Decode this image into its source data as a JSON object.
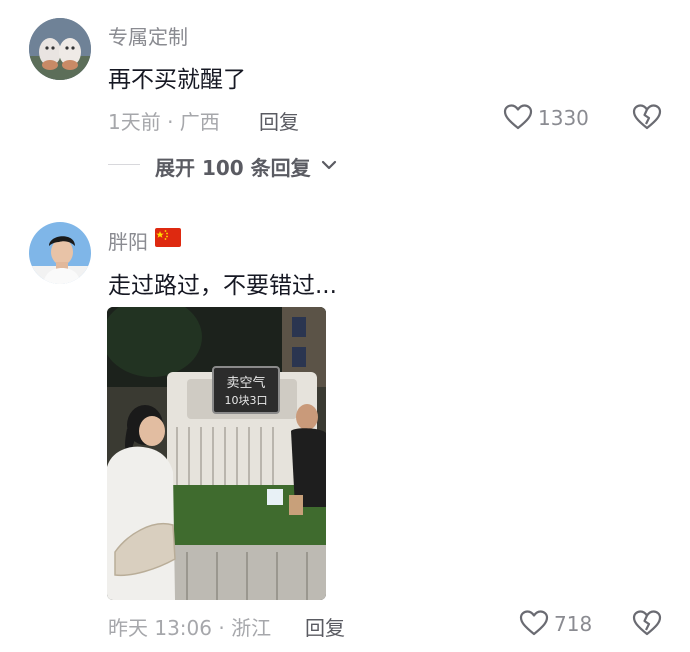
{
  "comments": [
    {
      "username": "专属定制",
      "text": "再不买就醒了",
      "meta": "1天前 · 广西",
      "reply_label": "回复",
      "like_count": "1330",
      "expand_label": "展开 100 条回复"
    },
    {
      "username": "胖阳",
      "text": "走过路过，不要错过...",
      "meta": "昨天 13:06 · 浙江",
      "reply_label": "回复",
      "like_count": "718",
      "image": {
        "sign_line1": "卖空气",
        "sign_line2": "10块3口"
      }
    }
  ]
}
